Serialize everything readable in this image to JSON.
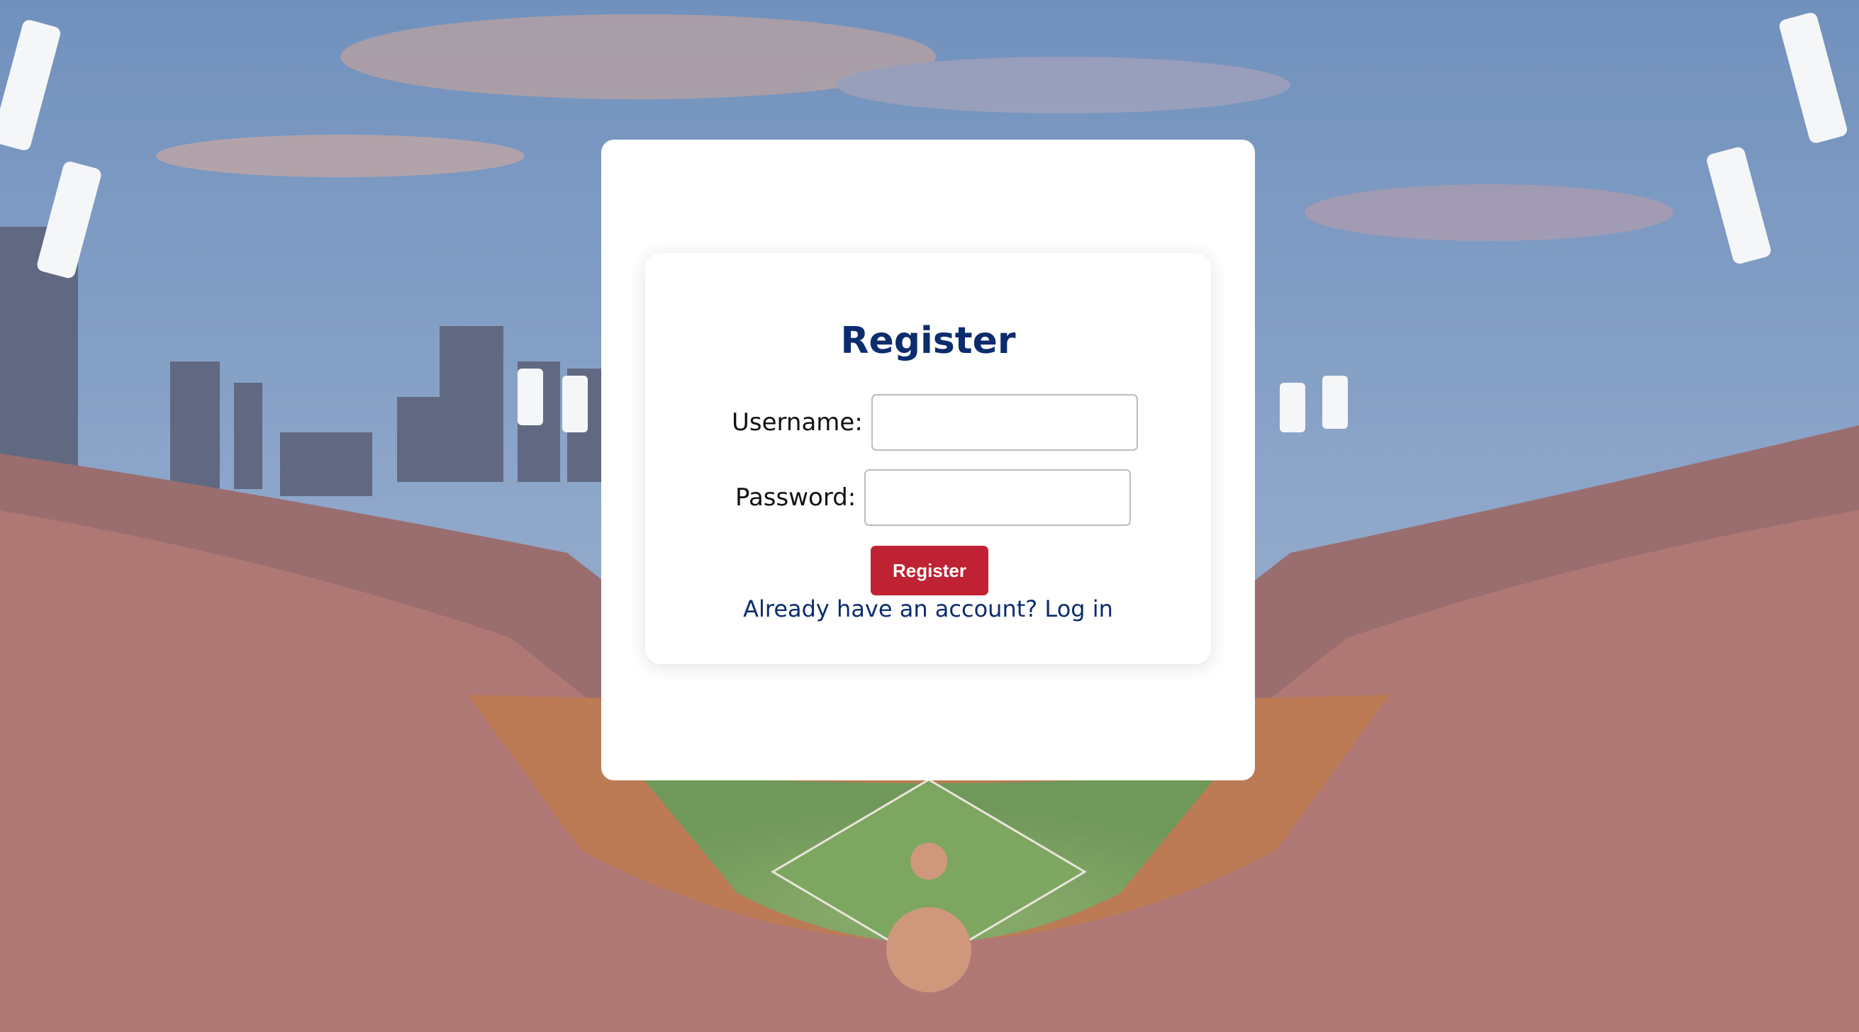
{
  "form": {
    "title": "Register",
    "username_label": "Username:",
    "username_value": "",
    "password_label": "Password:",
    "password_value": "",
    "submit_label": "Register",
    "login_link": "Already have an account? Log in"
  },
  "colors": {
    "title": "#0c2c6e",
    "button": "#bf2232",
    "link": "#0c2c6e",
    "card": "#ffffff"
  }
}
